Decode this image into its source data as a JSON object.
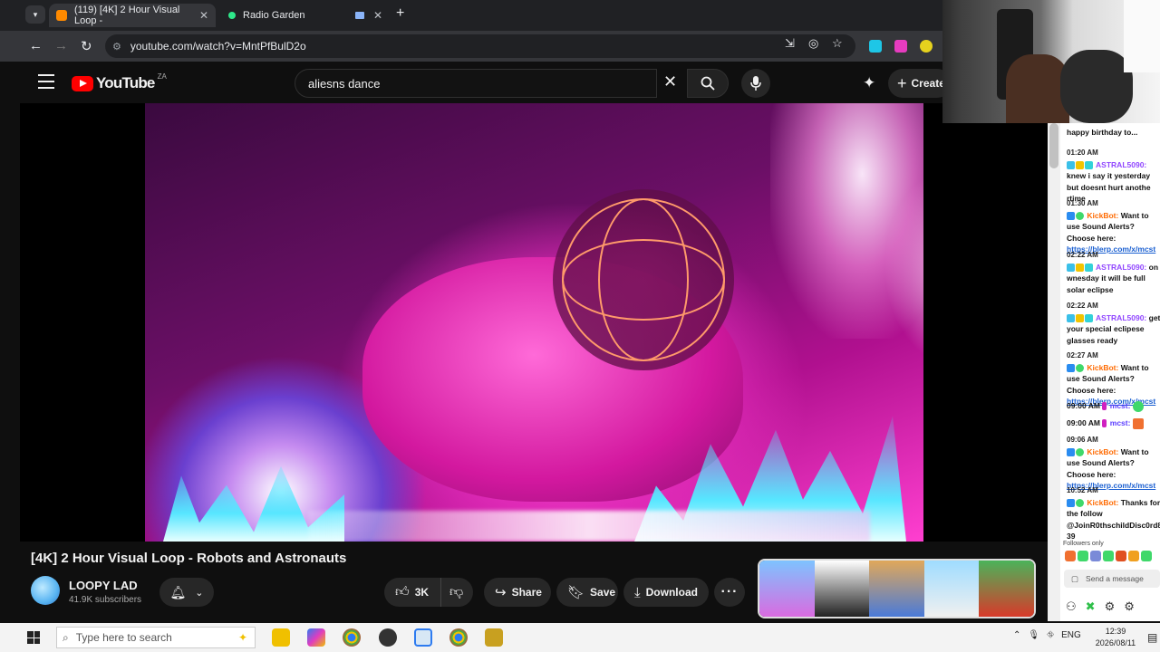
{
  "browser": {
    "tabs": [
      {
        "title": "(119) [4K] 2 Hour Visual Loop -",
        "active": true
      },
      {
        "title": "Radio Garden",
        "active": false
      }
    ],
    "url": "youtube.com/watch?v=MntPfBulD2o"
  },
  "youtube": {
    "logo_text": "YouTube",
    "country_code": "ZA",
    "search_value": "aliesns dance",
    "create_label": "Create"
  },
  "video": {
    "title": "[4K] 2 Hour Visual Loop - Robots and Astronauts",
    "channel": "LOOPY LAD",
    "subscribers": "41.9K subscribers",
    "likes": "3K",
    "share_label": "Share",
    "save_label": "Save",
    "download_label": "Download"
  },
  "chat": {
    "top_fragment": "happy birthday to...",
    "messages": [
      {
        "time": "01:20 AM",
        "user": "ASTRAL5090:",
        "text": "knew i say it yesterday but doesnt hurt anothe rtime"
      },
      {
        "time": "01:30 AM",
        "user": "KickBot:",
        "text": "Want to use Sound Alerts? Choose here:",
        "link": "https://blerp.com/x/mcst"
      },
      {
        "time": "02:22 AM",
        "user": "ASTRAL5090:",
        "text": "on wnesday it will be full solar eclipse"
      },
      {
        "time": "02:22 AM",
        "user": "ASTRAL5090:",
        "text": "get your special eclipese glasses ready"
      },
      {
        "time": "02:27 AM",
        "user": "KickBot:",
        "text": "Want to use Sound Alerts? Choose here:",
        "link": "https://blerp.com/x/mcst"
      },
      {
        "time": "09:00 AM",
        "user": "mcst:",
        "text": ""
      },
      {
        "time": "09:00 AM",
        "user": "mcst:",
        "text": ""
      },
      {
        "time": "09:06 AM",
        "user": "KickBot:",
        "text": "Want to use Sound Alerts? Choose here:",
        "link": "https://blerp.com/x/mcst"
      },
      {
        "time": "10:52 AM",
        "user": "KickBot:",
        "text": "Thanks for the follow @JoinR0thschildDisc0rd8 39"
      }
    ],
    "followers_only": "Followers only",
    "send_placeholder": "Send a message"
  },
  "taskbar": {
    "search_placeholder": "Type here to search",
    "language": "ENG",
    "time": "12:39",
    "date": "2026/08/11"
  }
}
